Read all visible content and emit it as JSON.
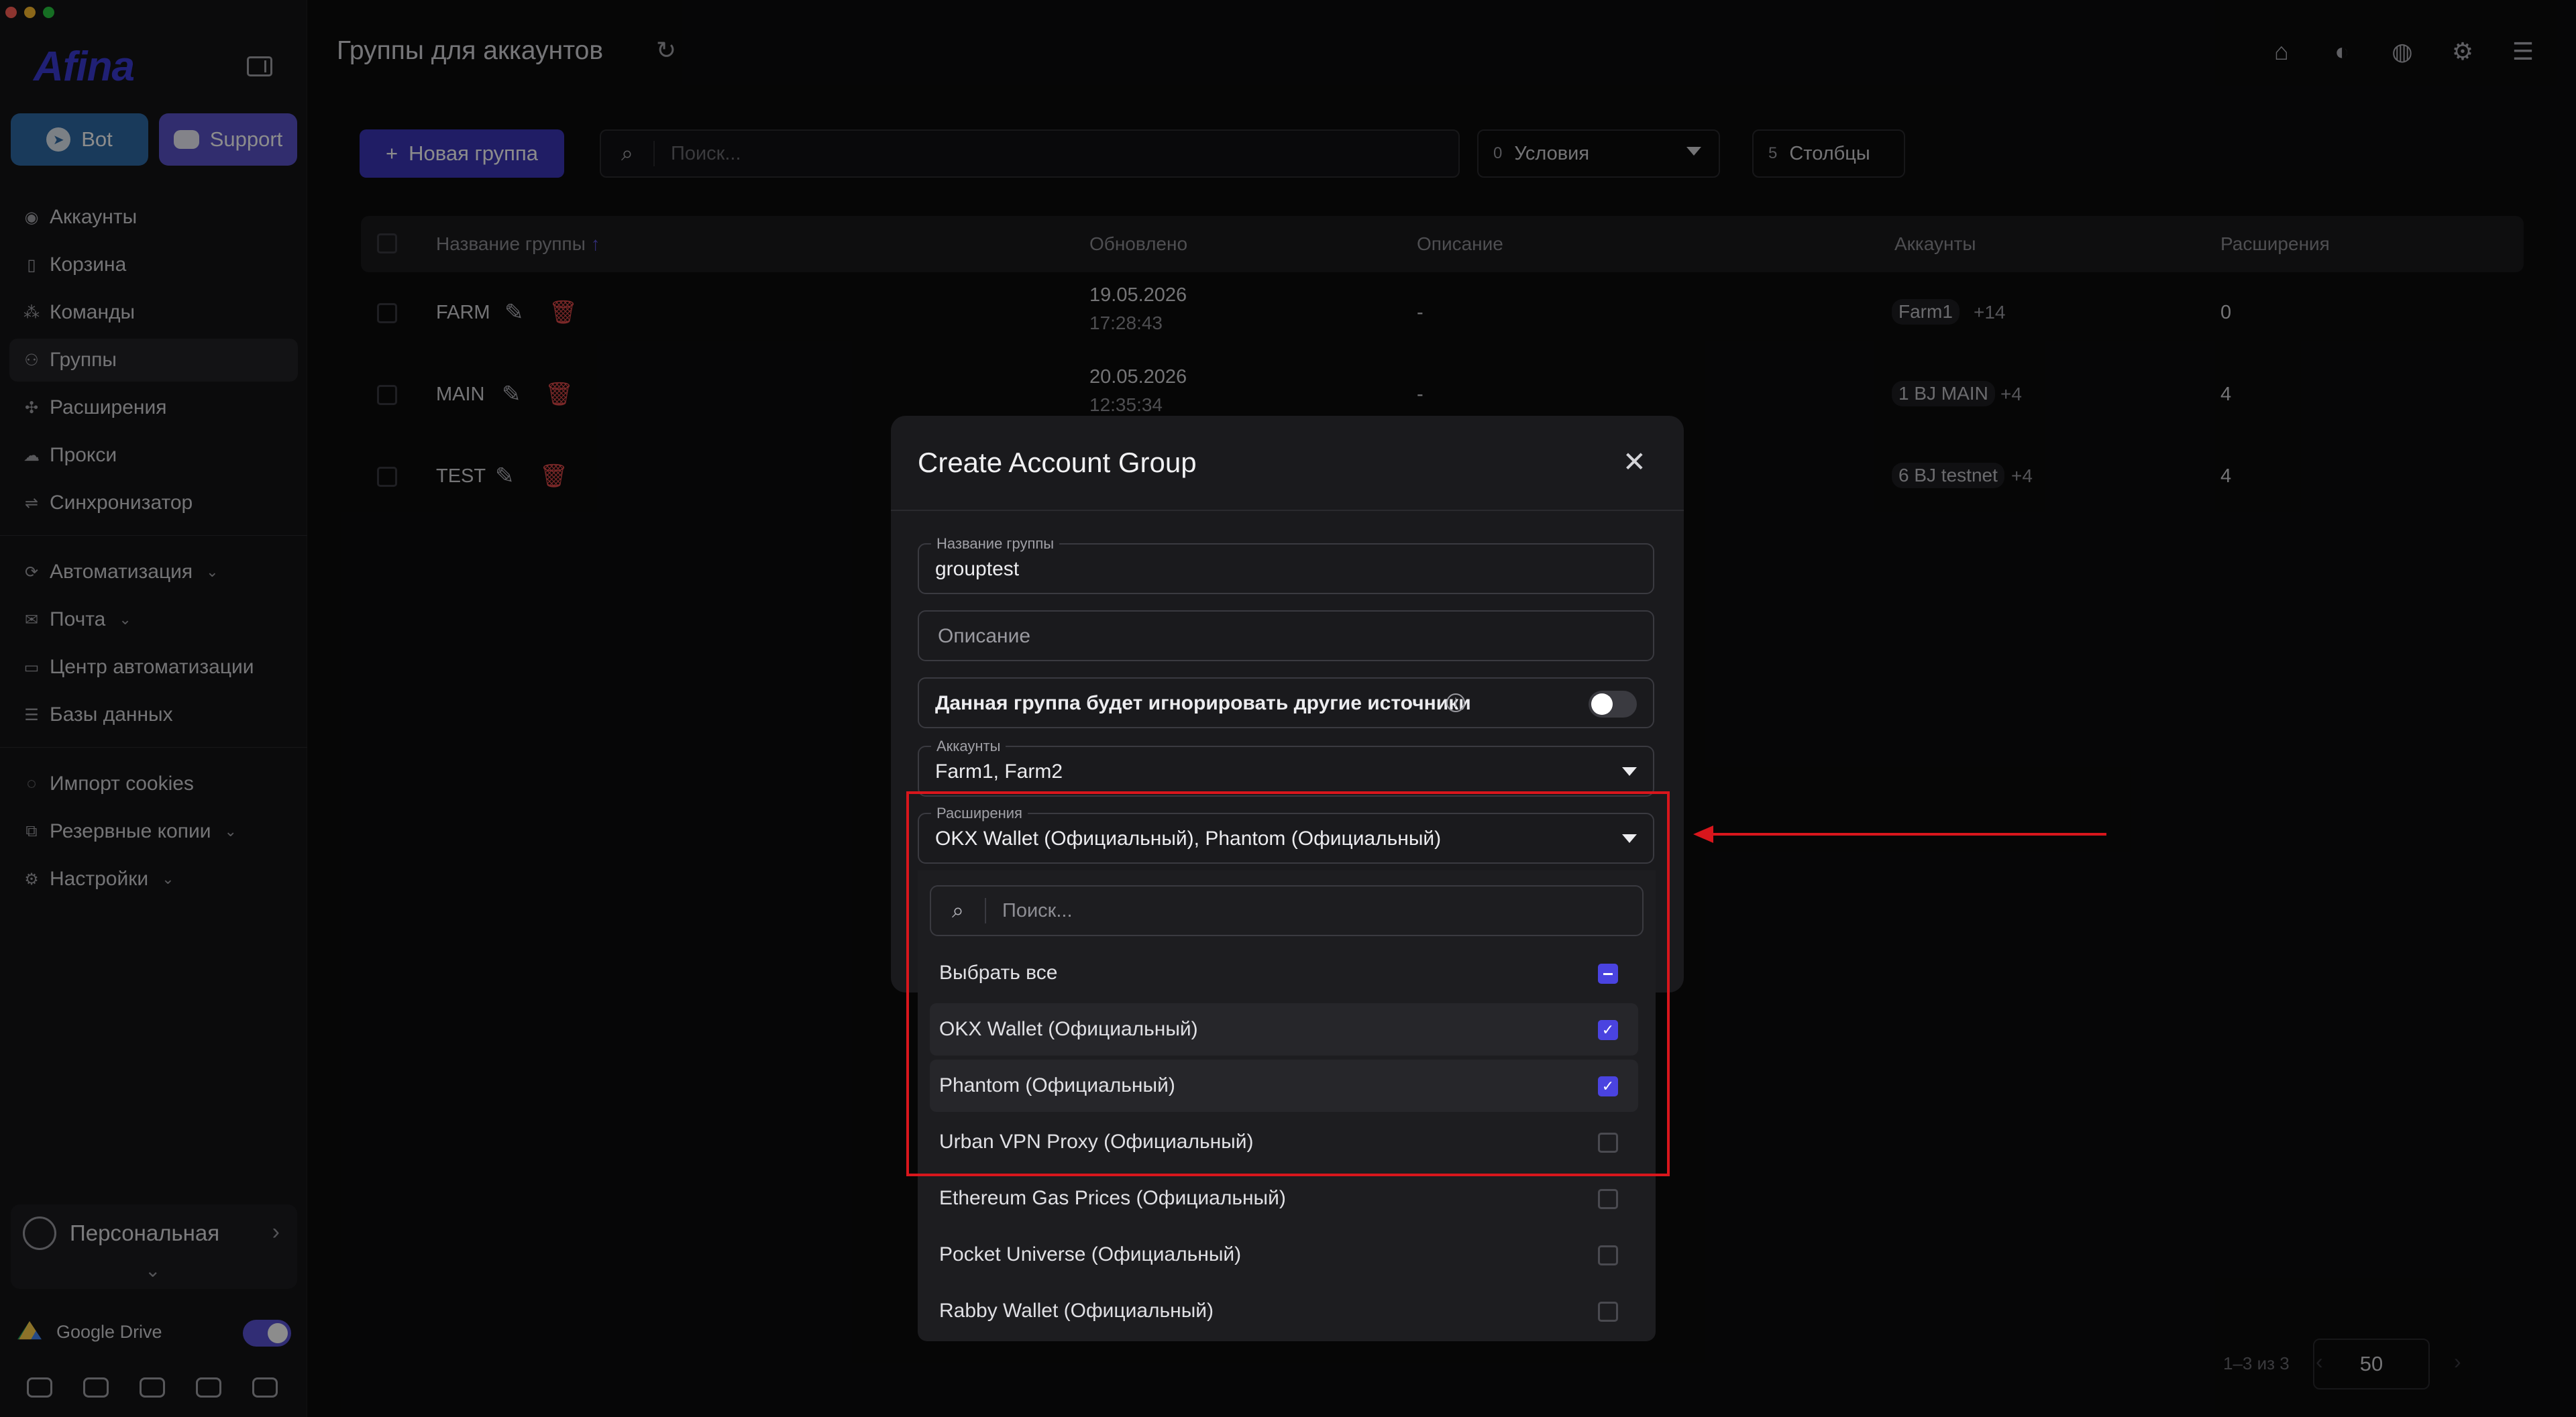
{
  "sidebar": {
    "logo": "Afina",
    "bot_label": "Bot",
    "support_label": "Support",
    "items": [
      {
        "label": "Аккаунты"
      },
      {
        "label": "Корзина"
      },
      {
        "label": "Команды"
      },
      {
        "label": "Группы",
        "active": true
      },
      {
        "label": "Расширения"
      },
      {
        "label": "Прокси"
      },
      {
        "label": "Синхронизатор"
      }
    ],
    "items2": [
      {
        "label": "Автоматизация"
      },
      {
        "label": "Почта"
      },
      {
        "label": "Центр автоматизации"
      },
      {
        "label": "Базы данных"
      }
    ],
    "items3": [
      {
        "label": "Импорт cookies"
      },
      {
        "label": "Резервные копии"
      },
      {
        "label": "Настройки"
      }
    ],
    "profile_name": "Персональная",
    "gdrive_label": "Google Drive"
  },
  "header": {
    "title": "Группы для аккаунтов"
  },
  "toolbar": {
    "new_group_label": "Новая группа",
    "search_placeholder": "Поиск...",
    "conditions_count": "0",
    "conditions_label": "Условия",
    "columns_count": "5",
    "columns_label": "Столбцы"
  },
  "table": {
    "headers": {
      "name": "Название группы",
      "updated": "Обновлено",
      "description": "Описание",
      "accounts": "Аккаунты",
      "extensions": "Расширения"
    },
    "rows": [
      {
        "name": "FARM",
        "date": "19.05.2026",
        "time": "17:28:43",
        "description": "-",
        "account_chip": "Farm1",
        "account_more": "+14",
        "extensions": "0"
      },
      {
        "name": "MAIN",
        "date": "20.05.2026",
        "time": "12:35:34",
        "description": "-",
        "account_chip": "1 BJ MAIN",
        "account_more": "+4",
        "extensions": "4"
      },
      {
        "name": "TEST",
        "date": "",
        "time": "",
        "description": "",
        "account_chip": "6 BJ testnet",
        "account_more": "+4",
        "extensions": "4"
      }
    ]
  },
  "pagination": {
    "info": "1–3 из 3",
    "page_size": "50"
  },
  "modal": {
    "title": "Create Account Group",
    "name_label": "Название группы",
    "name_value": "grouptest",
    "description_placeholder": "Описание",
    "ignore_sources_label": "Данная группа будет игнорировать другие источники",
    "accounts_label": "Аккаунты",
    "accounts_value": "Farm1, Farm2",
    "extensions_label": "Расширения",
    "extensions_value": "OKX Wallet (Официальный), Phantom (Официальный)"
  },
  "dropdown": {
    "search_placeholder": "Поиск...",
    "select_all_label": "Выбрать все",
    "options": [
      {
        "label": "OKX Wallet (Официальный)",
        "checked": true
      },
      {
        "label": "Phantom (Официальный)",
        "checked": true
      },
      {
        "label": "Urban VPN Proxy (Официальный)",
        "checked": false
      },
      {
        "label": "Ethereum Gas Prices (Официальный)",
        "checked": false
      },
      {
        "label": "Pocket Universe (Официальный)",
        "checked": false
      },
      {
        "label": "Rabby Wallet (Официальный)",
        "checked": false
      }
    ]
  },
  "colors": {
    "accent": "#4a43e0",
    "annotation": "#d8161c",
    "delete": "#e04a4a"
  }
}
